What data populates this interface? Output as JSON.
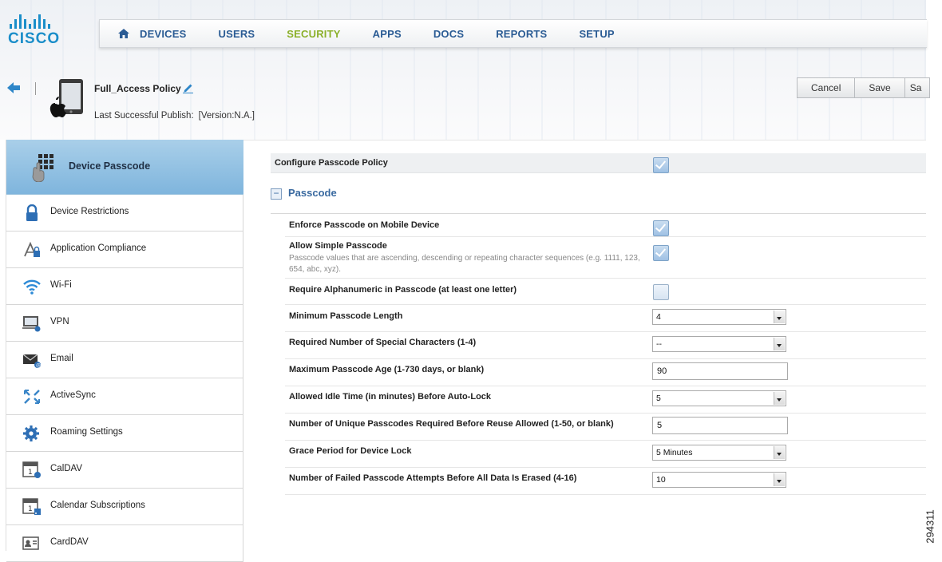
{
  "brand": {
    "logo_text": "CISCO",
    "accent": "#1b8ec9"
  },
  "nav": {
    "home_icon": "home-icon",
    "items": [
      {
        "label": "DEVICES"
      },
      {
        "label": "USERS"
      },
      {
        "label": "SECURITY",
        "active": true
      },
      {
        "label": "APPS"
      },
      {
        "label": "DOCS"
      },
      {
        "label": "REPORTS"
      },
      {
        "label": "SETUP"
      }
    ]
  },
  "header": {
    "policy_name": "Full_Access Policy",
    "publish_label": "Last Successful Publish:",
    "publish_value": "[Version:N.A.]",
    "buttons": {
      "cancel": "Cancel",
      "save": "Save",
      "save_publish_partial": "Sa"
    }
  },
  "sidebar": {
    "active": {
      "label": "Device Passcode",
      "icon": "keypad-icon"
    },
    "items": [
      {
        "label": "Device Restrictions",
        "icon": "lock-icon"
      },
      {
        "label": "Application Compliance",
        "icon": "app-lock-icon"
      },
      {
        "label": "Wi-Fi",
        "icon": "wifi-icon"
      },
      {
        "label": "VPN",
        "icon": "vpn-icon"
      },
      {
        "label": "Email",
        "icon": "email-icon"
      },
      {
        "label": "ActiveSync",
        "icon": "sync-icon"
      },
      {
        "label": "Roaming Settings",
        "icon": "gear-icon"
      },
      {
        "label": "CalDAV",
        "icon": "calendar-icon"
      },
      {
        "label": "Calendar Subscriptions",
        "icon": "calendar-rss-icon"
      },
      {
        "label": "CardDAV",
        "icon": "contact-card-icon"
      }
    ]
  },
  "main": {
    "configure_label": "Configure Passcode Policy",
    "configure_checked": true,
    "section_title": "Passcode",
    "fields": {
      "enforce": {
        "label": "Enforce Passcode on Mobile Device",
        "checked": true
      },
      "simple": {
        "label": "Allow Simple Passcode",
        "desc": "Passcode values that are ascending, descending or repeating character sequences (e.g. 1111, 123, 654, abc, xyz).",
        "checked": true
      },
      "alnum": {
        "label": "Require Alphanumeric in Passcode (at least one letter)",
        "checked": false
      },
      "min_len": {
        "label": "Minimum Passcode Length",
        "value": "4"
      },
      "special": {
        "label": "Required Number of Special Characters (1-4)",
        "value": "--"
      },
      "max_age": {
        "label": "Maximum Passcode Age (1-730 days, or blank)",
        "value": "90"
      },
      "idle": {
        "label": "Allowed Idle Time (in minutes) Before Auto-Lock",
        "value": "5"
      },
      "unique": {
        "label": "Number of Unique Passcodes Required Before Reuse Allowed (1-50, or blank)",
        "value": "5"
      },
      "grace": {
        "label": "Grace Period for Device Lock",
        "value": "5 Minutes"
      },
      "failed": {
        "label": "Number of Failed Passcode Attempts Before All Data Is Erased (4-16)",
        "value": "10"
      }
    }
  },
  "figure_number": "294311"
}
